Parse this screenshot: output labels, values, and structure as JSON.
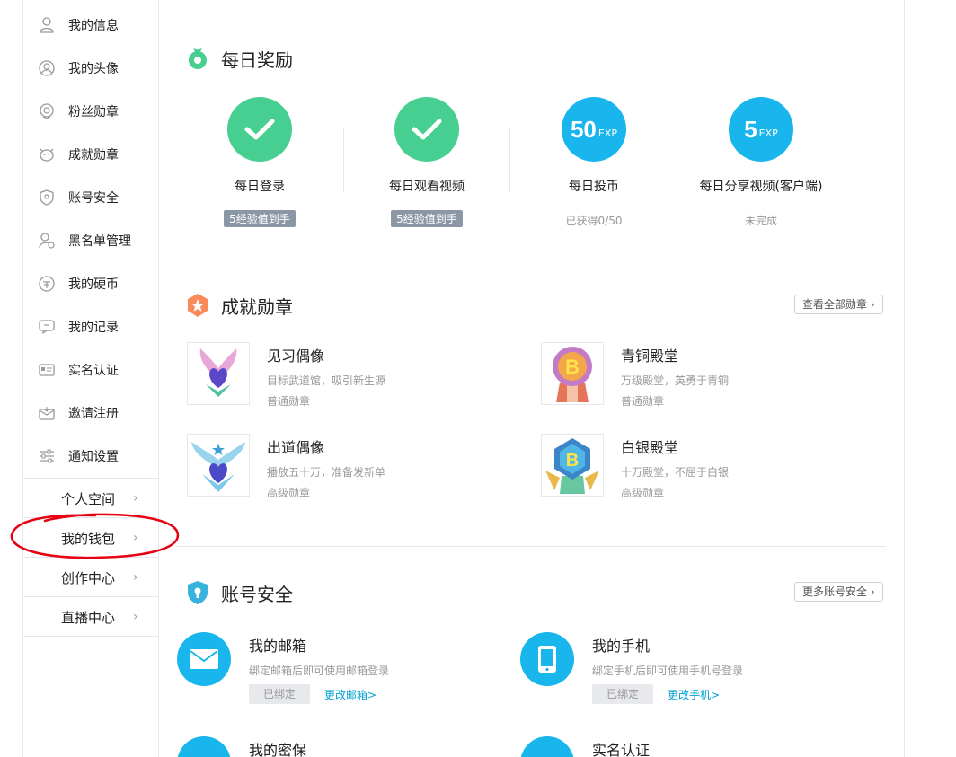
{
  "sidebar": {
    "items": [
      {
        "label": "我的信息",
        "icon": "user-icon"
      },
      {
        "label": "我的头像",
        "icon": "avatar-icon"
      },
      {
        "label": "粉丝勋章",
        "icon": "fan-medal-icon"
      },
      {
        "label": "成就勋章",
        "icon": "achievement-icon"
      },
      {
        "label": "账号安全",
        "icon": "shield-icon"
      },
      {
        "label": "黑名单管理",
        "icon": "blacklist-icon"
      },
      {
        "label": "我的硬币",
        "icon": "coin-icon"
      },
      {
        "label": "我的记录",
        "icon": "record-icon"
      },
      {
        "label": "实名认证",
        "icon": "id-card-icon"
      },
      {
        "label": "邀请注册",
        "icon": "invite-icon"
      },
      {
        "label": "通知设置",
        "icon": "settings-sliders-icon"
      }
    ],
    "groups": [
      {
        "label": "个人空间"
      },
      {
        "label": "我的钱包"
      },
      {
        "label": "创作中心"
      },
      {
        "label": "直播中心"
      }
    ]
  },
  "daily": {
    "title": "每日奖励",
    "rewards": [
      {
        "name": "每日登录",
        "status": "5经验值到手",
        "done": true
      },
      {
        "name": "每日观看视频",
        "status": "5经验值到手",
        "done": true
      },
      {
        "name": "每日投币",
        "status": "已获得0/50",
        "exp": "50",
        "unit": "EXP",
        "done": false
      },
      {
        "name": "每日分享视频(客户端)",
        "status": "未完成",
        "exp": "5",
        "unit": "EXP",
        "done": false
      }
    ]
  },
  "medals": {
    "title": "成就勋章",
    "more": "查看全部勋章",
    "items": [
      {
        "name": "见习偶像",
        "desc": "目标武道馆，吸引新生源",
        "level": "普通勋章"
      },
      {
        "name": "青铜殿堂",
        "desc": "万级殿堂，英勇于青铜",
        "level": "普通勋章"
      },
      {
        "name": "出道偶像",
        "desc": "播放五十万，准备发新单",
        "level": "高级勋章"
      },
      {
        "name": "白银殿堂",
        "desc": "十万殿堂，不屈于白银",
        "level": "高级勋章"
      }
    ]
  },
  "security": {
    "title": "账号安全",
    "more": "更多账号安全",
    "items": [
      {
        "name": "我的邮箱",
        "desc": "绑定邮箱后即可使用邮箱登录",
        "bound": "已绑定",
        "link": "更改邮箱>"
      },
      {
        "name": "我的手机",
        "desc": "绑定手机后即可使用手机号登录",
        "bound": "已绑定",
        "link": "更改手机>"
      },
      {
        "name": "我的密保"
      },
      {
        "name": "实名认证"
      }
    ]
  },
  "colors": {
    "accent": "#00a1d6",
    "green": "#47cf92",
    "blue": "#19b6ee",
    "annotation": "#e60012"
  }
}
